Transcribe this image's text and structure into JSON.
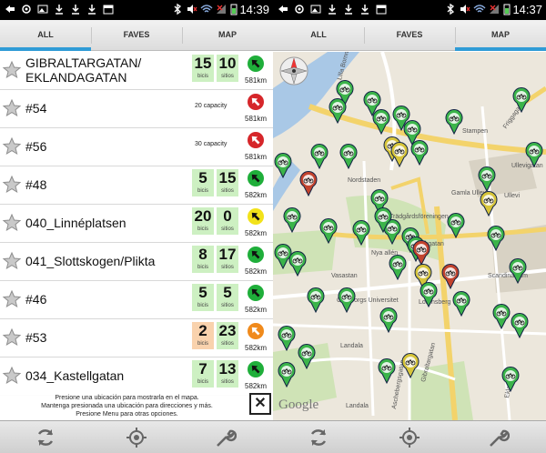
{
  "status": {
    "time_left": "14:39",
    "time_right": "14:37"
  },
  "tabs": [
    {
      "label": "ALL"
    },
    {
      "label": "FAVES"
    },
    {
      "label": "MAP"
    }
  ],
  "station_labels": {
    "bikes": "bicis",
    "slots": "sitios"
  },
  "stations": [
    {
      "name": "GIBRALTARGATAN/",
      "name2": "EKLANDAGATAN",
      "bikes": "15",
      "slots": "10",
      "capacity": "",
      "distance": "581km",
      "arrow": "green"
    },
    {
      "name": "#54",
      "bikes": "",
      "slots": "",
      "capacity": "20 capacity",
      "distance": "581km",
      "arrow": "red"
    },
    {
      "name": "#56",
      "bikes": "",
      "slots": "",
      "capacity": "30 capacity",
      "distance": "581km",
      "arrow": "red"
    },
    {
      "name": "#48",
      "bikes": "5",
      "slots": "15",
      "capacity": "",
      "distance": "582km",
      "arrow": "green"
    },
    {
      "name": "040_Linnéplatsen",
      "bikes": "20",
      "slots": "0",
      "capacity": "",
      "distance": "582km",
      "arrow": "yellow"
    },
    {
      "name": "041_Slottskogen/Plikta",
      "bikes": "8",
      "slots": "17",
      "capacity": "",
      "distance": "582km",
      "arrow": "green"
    },
    {
      "name": "#46",
      "bikes": "5",
      "slots": "5",
      "capacity": "",
      "distance": "582km",
      "arrow": "green"
    },
    {
      "name": "#53",
      "bikes": "2",
      "slots": "23",
      "capacity": "",
      "distance": "582km",
      "arrow": "orange"
    },
    {
      "name": "034_Kastellgatan",
      "bikes": "7",
      "slots": "13",
      "capacity": "",
      "distance": "582km",
      "arrow": "green"
    }
  ],
  "toast": {
    "line1": "Presione una ubicación para mostrarla en el mapa.",
    "line2": "Mantenga presionada una ubicación para direcciones y más.",
    "line3": "Presione Menu para otras opciones."
  },
  "map_labels": {
    "stampen": "Stampen",
    "ullevigatan": "Ullevigatan",
    "nordstaden": "Nordstaden",
    "gamla_ullevi": "Gamla Ullevi",
    "ullevi": "Ullevi",
    "tradgardsforeningen": "Trädgårdsföreningen",
    "parkgatan": "Parkgatan",
    "nya_allen": "Nya allén",
    "vasastan": "Vasastan",
    "scandinavium": "Scandinavium",
    "universitet": "Göteborgs Universitet",
    "lorensberg": "Lorensberg",
    "landala": "Landala",
    "landala2": "Landala",
    "gibraltargatan": "Gibraltargatan",
    "aschebergsgatan": "Aschebergsgatan",
    "eklanda": "Eklanda",
    "friggagatan": "Friggagatan",
    "lilla_bommen": "Lilla Bommen",
    "google": "Google"
  },
  "colors": {
    "accent": "#2f9bd6",
    "green": "#1fae3a",
    "red": "#d6262a",
    "yellow": "#f2e21a",
    "orange": "#f08a1c",
    "box_green": "#cdf0c2",
    "box_peach": "#f9d2ad"
  }
}
